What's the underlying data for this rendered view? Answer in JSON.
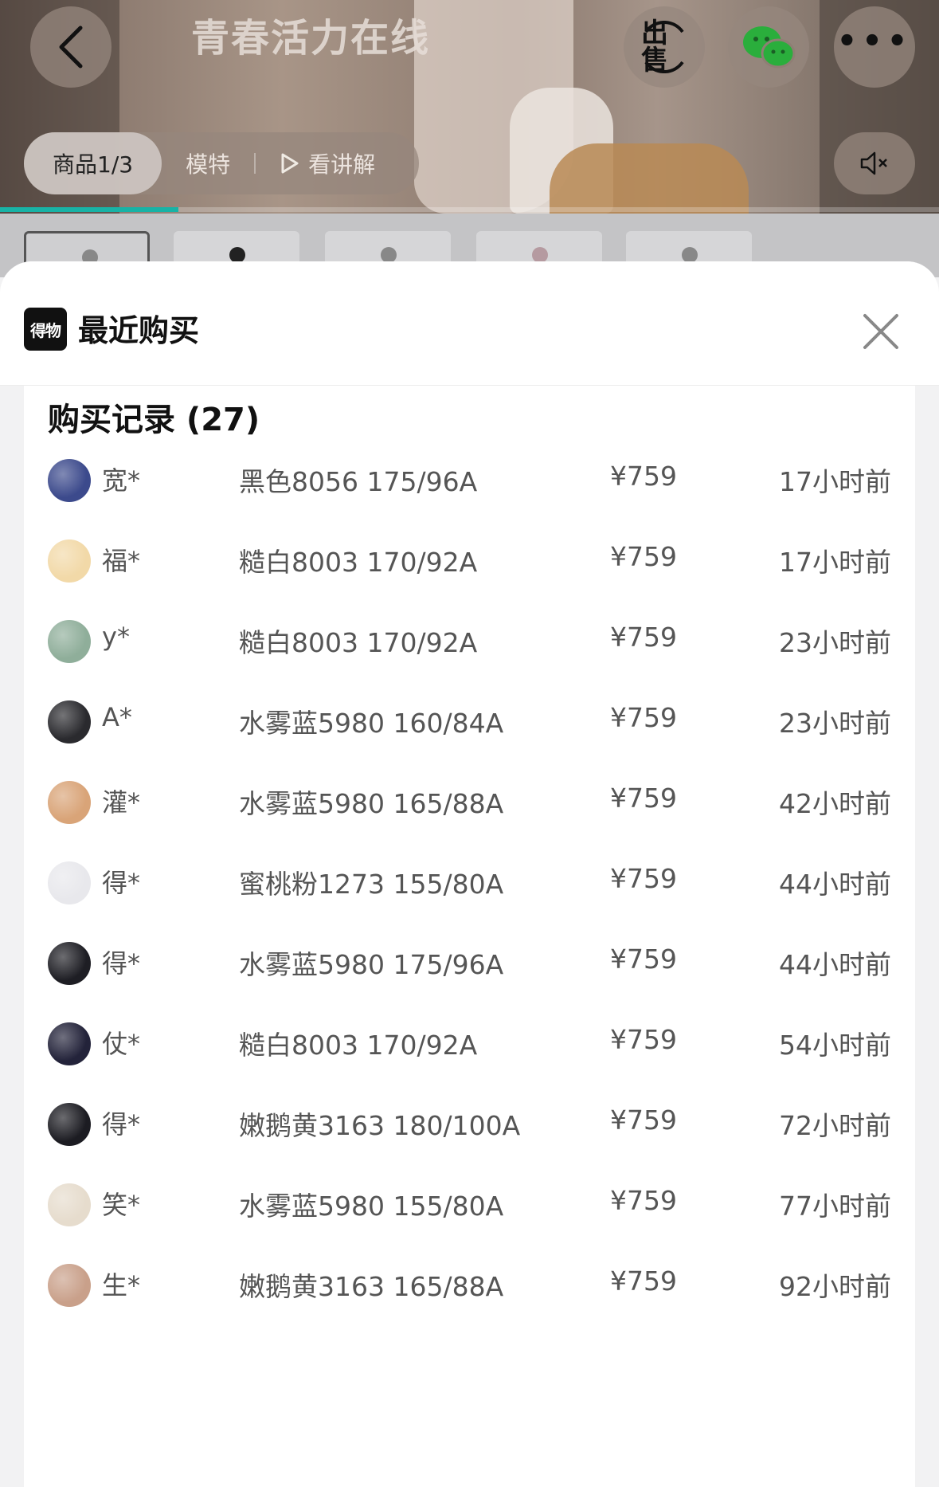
{
  "media": {
    "banner_text": "青春活力在线",
    "sell_label": "出售",
    "tabs": {
      "active": "商品1/3",
      "model": "模特",
      "explain": "看讲解"
    },
    "progress_fraction": 0.19
  },
  "sheet": {
    "app_logo_text": "得物",
    "title": "最近购买",
    "records_title": "购买记录 (27)"
  },
  "records": [
    {
      "name": "宽*",
      "spec": "黑色8056 175/96A",
      "price": "¥759",
      "time": "17小时前",
      "avatar_color": "#3c4a8c"
    },
    {
      "name": "福*",
      "spec": "糙白8003 170/92A",
      "price": "¥759",
      "time": "17小时前",
      "avatar_color": "#f2d9a8"
    },
    {
      "name": "y*",
      "spec": "糙白8003 170/92A",
      "price": "¥759",
      "time": "23小时前",
      "avatar_color": "#8fae9a"
    },
    {
      "name": "A*",
      "spec": "水雾蓝5980 160/84A",
      "price": "¥759",
      "time": "23小时前",
      "avatar_color": "#2a2a2e"
    },
    {
      "name": "灌*",
      "spec": "水雾蓝5980 165/88A",
      "price": "¥759",
      "time": "42小时前",
      "avatar_color": "#d9a478"
    },
    {
      "name": "得*",
      "spec": "蜜桃粉1273 155/80A",
      "price": "¥759",
      "time": "44小时前",
      "avatar_color": "#e8e8ec"
    },
    {
      "name": "得*",
      "spec": "水雾蓝5980 175/96A",
      "price": "¥759",
      "time": "44小时前",
      "avatar_color": "#1e1e24"
    },
    {
      "name": "仗*",
      "spec": "糙白8003 170/92A",
      "price": "¥759",
      "time": "54小时前",
      "avatar_color": "#23233a"
    },
    {
      "name": "得*",
      "spec": "嫩鹅黄3163 180/100A",
      "price": "¥759",
      "time": "72小时前",
      "avatar_color": "#1c1c22"
    },
    {
      "name": "笑*",
      "spec": "水雾蓝5980 155/80A",
      "price": "¥759",
      "time": "77小时前",
      "avatar_color": "#e6dccd"
    },
    {
      "name": "生*",
      "spec": "嫩鹅黄3163 165/88A",
      "price": "¥759",
      "time": "92小时前",
      "avatar_color": "#c9a08a"
    }
  ],
  "colors": {
    "accent": "#18b3a6",
    "text_primary": "#111111",
    "text_secondary": "#555555",
    "wechat_green": "#2aae3c"
  }
}
